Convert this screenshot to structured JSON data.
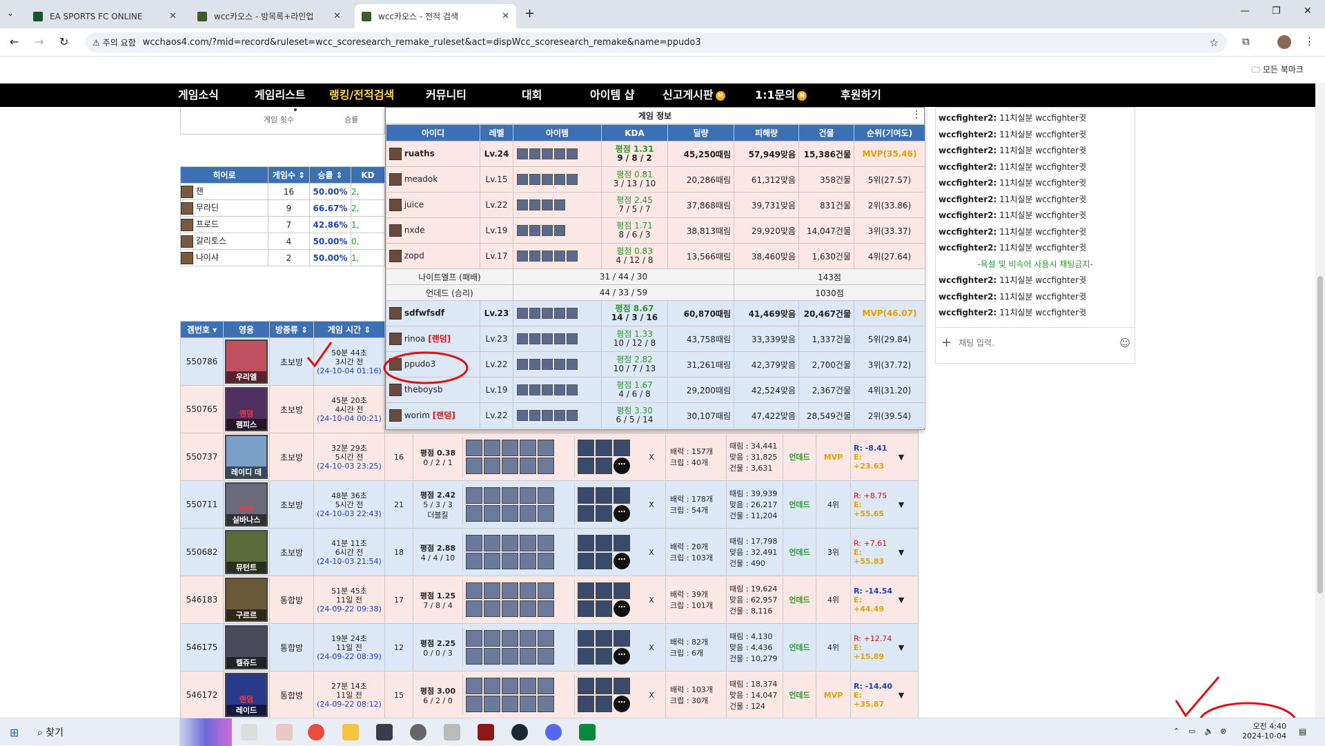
{
  "tabs": [
    {
      "label": "EA SPORTS FC ONLINE"
    },
    {
      "label": "wcc카오스 - 방목록+라인업"
    },
    {
      "label": "wcc카오스 - 전적 검색"
    }
  ],
  "browser": {
    "warning": "주의 요함",
    "url": "wcchaos4.com/?mid=record&ruleset=wcc_scoresearch_remake_ruleset&act=dispWcc_scoresearch_remake&name=ppudo3",
    "bookmarks": "모든 북마크"
  },
  "nav": [
    "게임소식",
    "게임리스트",
    "랭킹/전적검색",
    "커뮤니티",
    "대회",
    "아이템 샵",
    "신고게시판",
    "1:1문의",
    "후원하기"
  ],
  "left_small": {
    "games_label": "게임 횟수",
    "win_label": "승률"
  },
  "hero_table": {
    "headers": [
      "히어로",
      "게임수",
      "승률",
      "KD"
    ],
    "rows": [
      {
        "hero": "챈",
        "games": "16",
        "rate": "50.00%",
        "kd": "2,"
      },
      {
        "hero": "무라딘",
        "games": "9",
        "rate": "66.67%",
        "kd": "2,"
      },
      {
        "hero": "프로드",
        "games": "7",
        "rate": "42.86%",
        "kd": "1,"
      },
      {
        "hero": "갈리토스",
        "games": "4",
        "rate": "50.00%",
        "kd": "0,"
      },
      {
        "hero": "나이샤",
        "games": "2",
        "rate": "50.00%",
        "kd": "1,"
      }
    ]
  },
  "game_info": {
    "title": "게임 정보",
    "headers": [
      "아이디",
      "레벨",
      "아이템",
      "KDA",
      "딜량",
      "피해량",
      "건물",
      "순위(기여도)"
    ],
    "team1": [
      {
        "id": "ruaths",
        "lv": "Lv.24",
        "avg": "평점 1.31",
        "kda": "9 / 8 / 2",
        "deal": "45,250때림",
        "dmg": "57,949맞음",
        "bld": "15,386건물",
        "rank": "MVP(35.46)"
      },
      {
        "id": "meadok",
        "lv": "Lv.15",
        "avg": "평점 0.81",
        "kda": "3 / 13 / 10",
        "deal": "20,286때림",
        "dmg": "61,312맞음",
        "bld": "358건물",
        "rank": "5위(27.57)"
      },
      {
        "id": "juice",
        "lv": "Lv.22",
        "avg": "평점 2.45",
        "kda": "7 / 5 / 7",
        "deal": "37,868때림",
        "dmg": "39,731맞음",
        "bld": "831건물",
        "rank": "2위(33.86)"
      },
      {
        "id": "nxde",
        "lv": "Lv.19",
        "avg": "평점 1.71",
        "kda": "8 / 6 / 3",
        "deal": "38,813때림",
        "dmg": "29,920맞음",
        "bld": "14,047건물",
        "rank": "3위(33.37)"
      },
      {
        "id": "zopd",
        "lv": "Lv.17",
        "avg": "평점 0.83",
        "kda": "4 / 12 / 8",
        "deal": "13,566때림",
        "dmg": "38,460맞음",
        "bld": "1,630건물",
        "rank": "4위(27.64)"
      }
    ],
    "team1_summary": {
      "name": "나이트엘프 (패배)",
      "kda": "31 / 44 / 30",
      "pts": "143점"
    },
    "team2_summary": {
      "name": "언데드 (승리)",
      "kda": "44 / 33 / 59",
      "pts": "1030점"
    },
    "team2": [
      {
        "id": "sdfwfsdf",
        "lv": "Lv.23",
        "avg": "평점 8.67",
        "kda": "14 / 3 / 16",
        "deal": "60,870때림",
        "dmg": "41,469맞음",
        "bld": "20,467건물",
        "rank": "MVP(46.07)",
        "tag": ""
      },
      {
        "id": "rinoa",
        "lv": "Lv.23",
        "avg": "평점 1.33",
        "kda": "10 / 12 / 8",
        "deal": "43,758때림",
        "dmg": "33,339맞음",
        "bld": "1,337건물",
        "rank": "5위(29.84)",
        "tag": "[랜덤]"
      },
      {
        "id": "ppudo3",
        "lv": "Lv.22",
        "avg": "평점 2.82",
        "kda": "10 / 7 / 13",
        "deal": "31,261때림",
        "dmg": "42,379맞음",
        "bld": "2,700건물",
        "rank": "3위(37.72)",
        "tag": ""
      },
      {
        "id": "theboysb",
        "lv": "Lv.19",
        "avg": "평점 1.67",
        "kda": "4 / 6 / 8",
        "deal": "29,200때림",
        "dmg": "42,524맞음",
        "bld": "2,367건물",
        "rank": "4위(31.20)",
        "tag": ""
      },
      {
        "id": "worim",
        "lv": "Lv.22",
        "avg": "평점 3.30",
        "kda": "6 / 5 / 14",
        "deal": "30,107때림",
        "dmg": "47,422맞음",
        "bld": "28,549건물",
        "rank": "2위(39.54)",
        "tag": "[랜덤]"
      }
    ]
  },
  "match_table": {
    "headers": [
      "겜번호",
      "영웅",
      "방종류",
      "게임 시간"
    ],
    "rows": [
      {
        "no": "550786",
        "hero": "우리엘",
        "room": "초보방",
        "time": "50분 44초",
        "ago": "3시간 전",
        "date": "(24-10-04 01:16)"
      },
      {
        "no": "550765",
        "hero": "램피스",
        "room": "초보방",
        "time": "45분 20초",
        "ago": "4시간 전",
        "date": "(24-10-04 00:21)",
        "tag": "랜덤"
      },
      {
        "no": "550737",
        "hero": "레이디 데",
        "room": "초보방",
        "time": "32분 29초",
        "ago": "5시간 전",
        "date": "(24-10-03 23:25)",
        "lv": "16",
        "avg": "평점 0.38",
        "kda": "0 / 2 / 1",
        "extra": "",
        "pow": "배럭 : 157개",
        "crp": "크립 : 40개",
        "hit": "때림 : 34,441",
        "taken": "맞음 : 31,825",
        "bld": "건물 : 3,631",
        "race": "언데드",
        "rank": "MVP",
        "r": "R: -8.41",
        "e": "E: +23.63"
      },
      {
        "no": "550711",
        "hero": "실바나스",
        "room": "초보방",
        "time": "48분 36초",
        "ago": "5시간 전",
        "date": "(24-10-03 22:43)",
        "tag": "랜덤",
        "lv": "21",
        "avg": "평점 2.42",
        "kda": "5 / 3 / 3",
        "extra": "더블킬",
        "pow": "배럭 : 178개",
        "crp": "크립 : 54개",
        "hit": "때림 : 39,939",
        "taken": "맞음 : 26,217",
        "bld": "건물 : 11,204",
        "race": "언데드",
        "rank": "4위",
        "r": "R: +8.75",
        "e": "E: +55.65"
      },
      {
        "no": "550682",
        "hero": "뮤턴트",
        "room": "초보방",
        "time": "41분 11초",
        "ago": "6시간 전",
        "date": "(24-10-03 21:54)",
        "lv": "18",
        "avg": "평점 2.88",
        "kda": "4 / 4 / 10",
        "extra": "",
        "pow": "배럭 : 20개",
        "crp": "크립 : 103개",
        "hit": "때림 : 17,798",
        "taken": "맞음 : 32,491",
        "bld": "건물 : 490",
        "race": "언데드",
        "rank": "3위",
        "r": "R: +7.61",
        "e": "E: +55.83"
      },
      {
        "no": "546183",
        "hero": "구르르",
        "room": "통합방",
        "time": "51분 45초",
        "ago": "11일 전",
        "date": "(24-09-22 09:38)",
        "lv": "17",
        "avg": "평점 1.25",
        "kda": "7 / 8 / 4",
        "extra": "",
        "pow": "배럭 : 39개",
        "crp": "크립 : 101개",
        "hit": "때림 : 19,624",
        "taken": "맞음 : 62,957",
        "bld": "건물 : 8,116",
        "race": "언데드",
        "rank": "4위",
        "r": "R: -14.54",
        "e": "E: +44.49"
      },
      {
        "no": "546175",
        "hero": "켈쥬드",
        "room": "통합방",
        "time": "19분 24초",
        "ago": "11일 전",
        "date": "(24-09-22 08:39)",
        "lv": "12",
        "avg": "평점 2.25",
        "kda": "0 / 0 / 3",
        "extra": "",
        "pow": "배럭 : 82개",
        "crp": "크립 : 6개",
        "hit": "때림 : 4,130",
        "taken": "맞음 : 4,436",
        "bld": "건물 : 10,279",
        "race": "언데드",
        "rank": "4위",
        "r": "R: +12.74",
        "e": "E: +15.89"
      },
      {
        "no": "546172",
        "hero": "레이드",
        "room": "통합방",
        "time": "27분 14초",
        "ago": "11일 전",
        "date": "(24-09-22 08:12)",
        "tag": "랜덤",
        "lv": "15",
        "avg": "평점 3.00",
        "kda": "6 / 2 / 0",
        "extra": "",
        "pow": "배럭 : 103개",
        "crp": "크립 : 30개",
        "hit": "때림 : 18,374",
        "taken": "맞음 : 14,047",
        "bld": "건물 : 124",
        "race": "언데드",
        "rank": "MVP",
        "r": "R: -14.40",
        "e": "E: +35.87"
      }
    ]
  },
  "chat": {
    "msgs": [
      {
        "user": "wccfighter2:",
        "text": "11치실분 wccfighter귓"
      },
      {
        "user": "wccfighter2:",
        "text": "11치실분 wccfighter귓"
      },
      {
        "user": "wccfighter2:",
        "text": "11치실분 wccfighter귓"
      },
      {
        "user": "wccfighter2:",
        "text": "11치실분 wccfighter귓"
      },
      {
        "user": "wccfighter2:",
        "text": "11치실분 wccfighter귓"
      },
      {
        "user": "wccfighter2:",
        "text": "11치실분 wccfighter귓"
      },
      {
        "user": "wccfighter2:",
        "text": "11치실분 wccfighter귓"
      },
      {
        "user": "wccfighter2:",
        "text": "11치실분 wccfighter귓"
      },
      {
        "user": "wccfighter2:",
        "text": "11치실분 wccfighter귓"
      }
    ],
    "notice": "-욕설 및 비속어 사용시 채팅금지-",
    "msgs2": [
      {
        "user": "wccfighter2:",
        "text": "11치실분 wccfighter귓"
      },
      {
        "user": "wccfighter2:",
        "text": "11치실분 wccfighter귓"
      },
      {
        "user": "wccfighter2:",
        "text": "11치실분 wccfighter귓"
      }
    ],
    "placeholder": "채팅 입력."
  },
  "taskbar": {
    "search": "찾기",
    "time": "오전 4:40",
    "date": "2024-10-04"
  }
}
